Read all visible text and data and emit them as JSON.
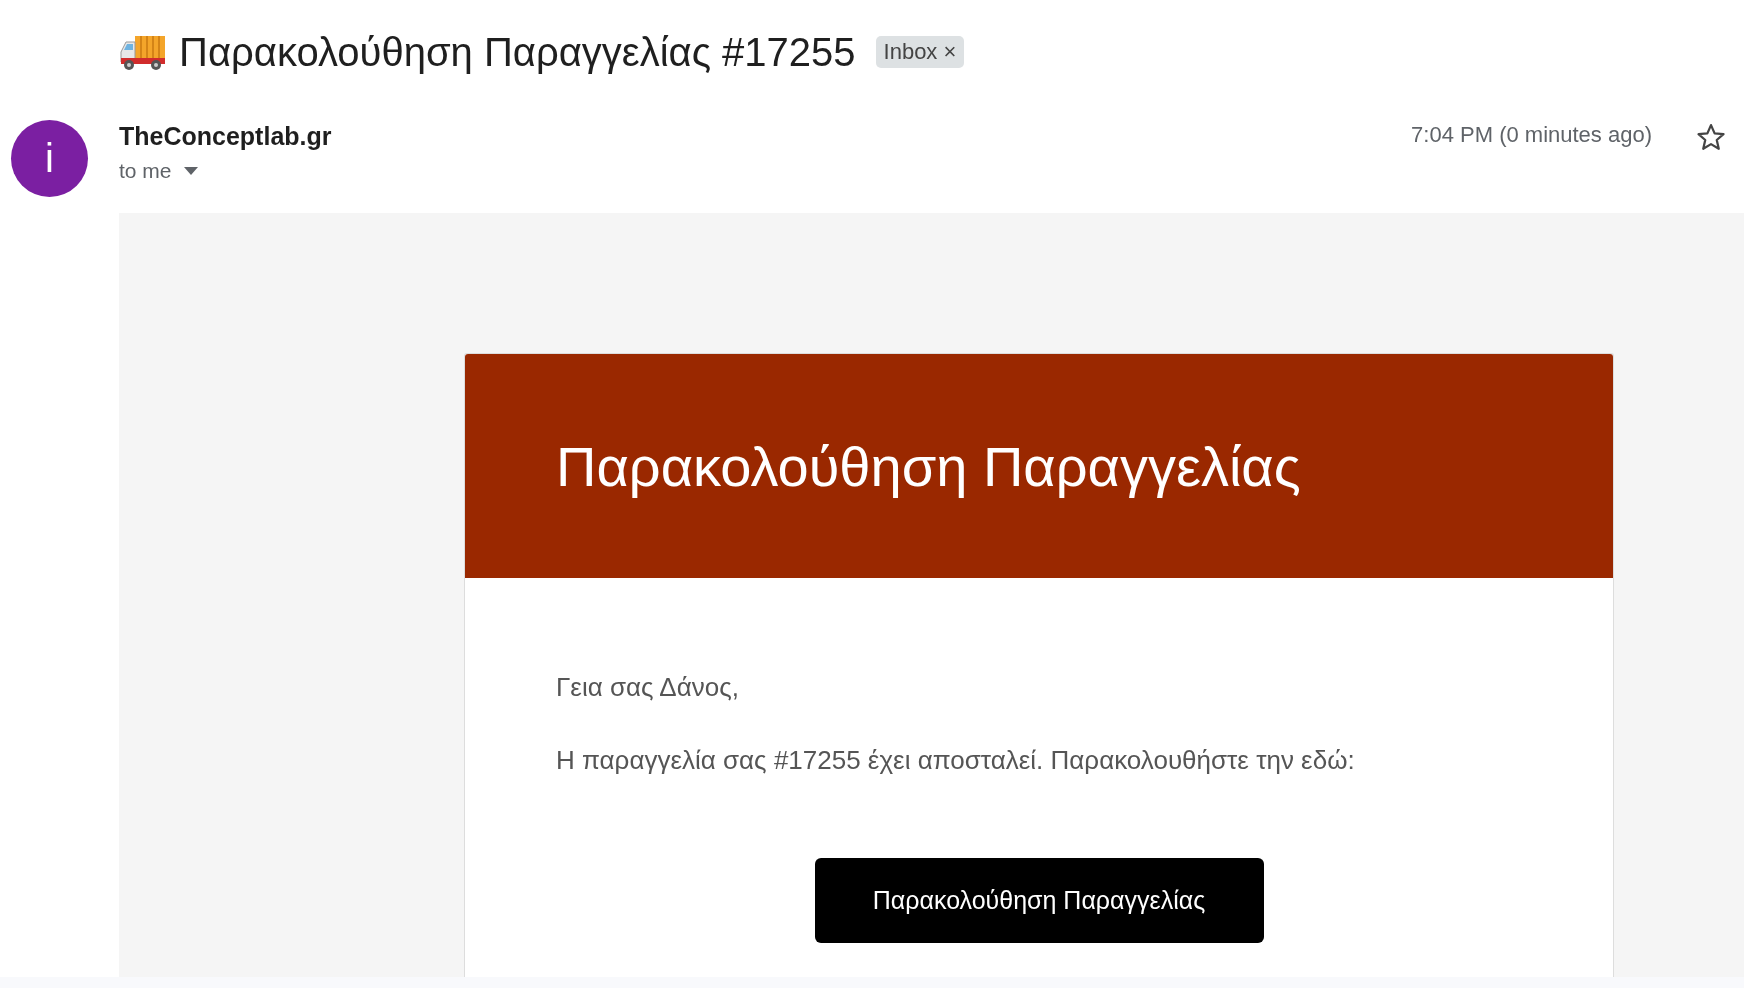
{
  "subject": {
    "title": "Παρακολούθηση Παραγγελίας #17255",
    "label": "Inbox",
    "label_close": "×"
  },
  "sender": {
    "avatar": "i",
    "name": "TheConceptlab.gr",
    "recipient": "to me",
    "time": "7:04 PM (0 minutes ago)",
    "starred": false
  },
  "email": {
    "header": "Παρακολούθηση Παραγγελίας",
    "greeting": "Γεια σας Δάνος,",
    "message": "Η παραγγελία σας #17255 έχει αποσταλεί. Παρακολουθήστε την εδώ:",
    "button": "Παρακολούθηση Παραγγελίας"
  }
}
